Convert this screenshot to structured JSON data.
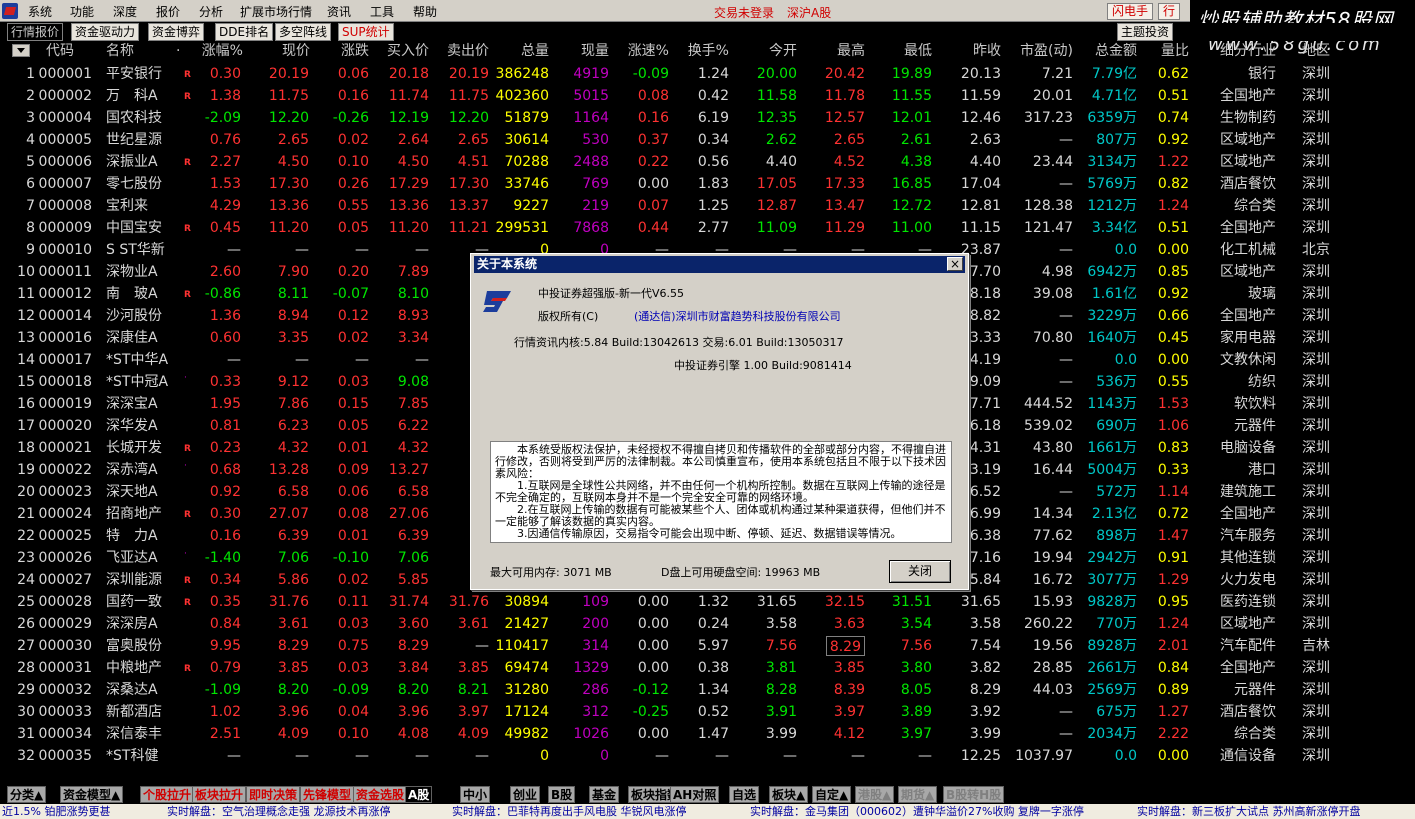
{
  "menu": [
    "系统",
    "功能",
    "深度",
    "报价",
    "分析",
    "扩展市场行情",
    "资讯",
    "工具",
    "帮助"
  ],
  "status": {
    "login": "交易未登录",
    "market": "深沪A股"
  },
  "toolbar": {
    "btn1": "闪电手",
    "btn2": "行"
  },
  "watermark": {
    "line1": "炒股辅助教材58股网",
    "line2": "www.58gu.com"
  },
  "top_tabs": [
    "行情报价",
    "资金驱动力",
    "资金博弈",
    "DDE排名",
    "多空阵线",
    "SUP统计"
  ],
  "theme_tab": "主题投资",
  "columns": [
    "代码",
    "名称",
    "·",
    "涨幅%",
    "现价",
    "涨跌",
    "买入价",
    "卖出价",
    "总量",
    "现量",
    "涨速%",
    "换手%",
    "今开",
    "最高",
    "最低",
    "昨收",
    "市盈(动)",
    "总金额",
    "量比",
    "细分行业",
    "地区"
  ],
  "rows": [
    [
      "1",
      "000001",
      "平安银行",
      "R",
      "0.30",
      "20.19",
      "0.06",
      "20.18",
      "20.19",
      "386248",
      "4919",
      "-0.09",
      "1.24",
      "20.00",
      "20.42",
      "19.89",
      "20.13",
      "7.21",
      "7.79亿",
      "0.62",
      "银行",
      "深圳"
    ],
    [
      "2",
      "000002",
      "万　科A",
      "R",
      "1.38",
      "11.75",
      "0.16",
      "11.74",
      "11.75",
      "402360",
      "5015",
      "0.08",
      "0.42",
      "11.58",
      "11.78",
      "11.55",
      "11.59",
      "20.01",
      "4.71亿",
      "0.51",
      "全国地产",
      "深圳"
    ],
    [
      "3",
      "000004",
      "国农科技",
      "",
      "-2.09",
      "12.20",
      "-0.26",
      "12.19",
      "12.20",
      "51879",
      "1164",
      "0.16",
      "6.19",
      "12.35",
      "12.57",
      "12.01",
      "12.46",
      "317.23",
      "6359万",
      "0.74",
      "生物制药",
      "深圳"
    ],
    [
      "4",
      "000005",
      "世纪星源",
      "",
      "0.76",
      "2.65",
      "0.02",
      "2.64",
      "2.65",
      "30614",
      "530",
      "0.37",
      "0.34",
      "2.62",
      "2.65",
      "2.61",
      "2.63",
      "—",
      "807万",
      "0.92",
      "区域地产",
      "深圳"
    ],
    [
      "5",
      "000006",
      "深振业A",
      "R",
      "2.27",
      "4.50",
      "0.10",
      "4.50",
      "4.51",
      "70288",
      "2488",
      "0.22",
      "0.56",
      "4.40",
      "4.52",
      "4.38",
      "4.40",
      "23.44",
      "3134万",
      "1.22",
      "区域地产",
      "深圳"
    ],
    [
      "6",
      "000007",
      "零七股份",
      "",
      "1.53",
      "17.30",
      "0.26",
      "17.29",
      "17.30",
      "33746",
      "769",
      "0.00",
      "1.83",
      "17.05",
      "17.33",
      "16.85",
      "17.04",
      "—",
      "5769万",
      "0.82",
      "酒店餐饮",
      "深圳"
    ],
    [
      "7",
      "000008",
      "宝利来",
      "",
      "4.29",
      "13.36",
      "0.55",
      "13.36",
      "13.37",
      "9227",
      "219",
      "0.07",
      "1.25",
      "12.87",
      "13.47",
      "12.72",
      "12.81",
      "128.38",
      "1212万",
      "1.24",
      "综合类",
      "深圳"
    ],
    [
      "8",
      "000009",
      "中国宝安",
      "R",
      "0.45",
      "11.20",
      "0.05",
      "11.20",
      "11.21",
      "299531",
      "7868",
      "0.44",
      "2.77",
      "11.09",
      "11.29",
      "11.00",
      "11.15",
      "121.47",
      "3.34亿",
      "0.51",
      "全国地产",
      "深圳"
    ],
    [
      "9",
      "000010",
      "S ST华新",
      "",
      "—",
      "—",
      "—",
      "—",
      "—",
      "0",
      "0",
      "—",
      "—",
      "—",
      "—",
      "—",
      "23.87",
      "—",
      "0.0",
      "0.00",
      "化工机械",
      "北京"
    ],
    [
      "10",
      "000011",
      "深物业A",
      "",
      "2.60",
      "7.90",
      "0.20",
      "7.89",
      "",
      "",
      "",
      "",
      "",
      "",
      "",
      "",
      "7.70",
      "4.98",
      "6942万",
      "0.85",
      "区域地产",
      "深圳"
    ],
    [
      "11",
      "000012",
      "南　玻A",
      "R",
      "-0.86",
      "8.11",
      "-0.07",
      "8.10",
      "",
      "",
      "",
      "",
      "",
      "",
      "",
      "",
      "8.18",
      "39.08",
      "1.61亿",
      "0.92",
      "玻璃",
      "深圳"
    ],
    [
      "12",
      "000014",
      "沙河股份",
      "",
      "1.36",
      "8.94",
      "0.12",
      "8.93",
      "",
      "",
      "",
      "",
      "",
      "",
      "",
      "",
      "8.82",
      "—",
      "3229万",
      "0.66",
      "全国地产",
      "深圳"
    ],
    [
      "13",
      "000016",
      "深康佳A",
      "",
      "0.60",
      "3.35",
      "0.02",
      "3.34",
      "",
      "",
      "",
      "",
      "",
      "",
      "",
      "",
      "3.33",
      "70.80",
      "1640万",
      "0.45",
      "家用电器",
      "深圳"
    ],
    [
      "14",
      "000017",
      "*ST中华A",
      "",
      "—",
      "—",
      "—",
      "—",
      "",
      "",
      "",
      "",
      "",
      "",
      "",
      "",
      "4.19",
      "—",
      "0.0",
      "0.00",
      "文教休闲",
      "深圳"
    ],
    [
      "15",
      "000018",
      "*ST中冠A",
      "·",
      "0.33",
      "9.12",
      "0.03",
      "9.08",
      "",
      "",
      "",
      "",
      "",
      "",
      "",
      "",
      "9.09",
      "—",
      "536万",
      "0.55",
      "纺织",
      "深圳"
    ],
    [
      "16",
      "000019",
      "深深宝A",
      "",
      "1.95",
      "7.86",
      "0.15",
      "7.85",
      "",
      "",
      "",
      "",
      "",
      "",
      "",
      "",
      "7.71",
      "444.52",
      "1143万",
      "1.53",
      "软饮料",
      "深圳"
    ],
    [
      "17",
      "000020",
      "深华发A",
      "",
      "0.81",
      "6.23",
      "0.05",
      "6.22",
      "",
      "",
      "",
      "",
      "",
      "",
      "",
      "",
      "6.18",
      "539.02",
      "690万",
      "1.06",
      "元器件",
      "深圳"
    ],
    [
      "18",
      "000021",
      "长城开发",
      "R",
      "0.23",
      "4.32",
      "0.01",
      "4.32",
      "",
      "",
      "",
      "",
      "",
      "",
      "",
      "",
      "4.31",
      "43.80",
      "1661万",
      "0.83",
      "电脑设备",
      "深圳"
    ],
    [
      "19",
      "000022",
      "深赤湾A",
      "·",
      "0.68",
      "13.28",
      "0.09",
      "13.27",
      "",
      "",
      "",
      "",
      "",
      "",
      "",
      "",
      "13.19",
      "16.44",
      "5004万",
      "0.33",
      "港口",
      "深圳"
    ],
    [
      "20",
      "000023",
      "深天地A",
      "",
      "0.92",
      "6.58",
      "0.06",
      "6.58",
      "",
      "",
      "",
      "",
      "",
      "",
      "",
      "",
      "6.52",
      "—",
      "572万",
      "1.14",
      "建筑施工",
      "深圳"
    ],
    [
      "21",
      "000024",
      "招商地产",
      "R",
      "0.30",
      "27.07",
      "0.08",
      "27.06",
      "",
      "",
      "",
      "",
      "",
      "",
      "",
      "",
      "26.99",
      "14.34",
      "2.13亿",
      "0.72",
      "全国地产",
      "深圳"
    ],
    [
      "22",
      "000025",
      "特　力A",
      "",
      "0.16",
      "6.39",
      "0.01",
      "6.39",
      "",
      "",
      "",
      "",
      "",
      "",
      "",
      "",
      "6.38",
      "77.62",
      "898万",
      "1.47",
      "汽车服务",
      "深圳"
    ],
    [
      "23",
      "000026",
      "飞亚达A",
      "·",
      "-1.40",
      "7.06",
      "-0.10",
      "7.06",
      "",
      "",
      "",
      "",
      "",
      "",
      "",
      "",
      "7.16",
      "19.94",
      "2942万",
      "0.91",
      "其他连锁",
      "深圳"
    ],
    [
      "24",
      "000027",
      "深圳能源",
      "R",
      "0.34",
      "5.86",
      "0.02",
      "5.85",
      "",
      "",
      "",
      "",
      "",
      "",
      "",
      "",
      "5.84",
      "16.72",
      "3077万",
      "1.29",
      "火力发电",
      "深圳"
    ],
    [
      "25",
      "000028",
      "国药一致",
      "R",
      "0.35",
      "31.76",
      "0.11",
      "31.74",
      "31.76",
      "30894",
      "109",
      "0.00",
      "1.32",
      "31.65",
      "32.15",
      "31.51",
      "31.65",
      "15.93",
      "9828万",
      "0.95",
      "医药连锁",
      "深圳"
    ],
    [
      "26",
      "000029",
      "深深房A",
      "",
      "0.84",
      "3.61",
      "0.03",
      "3.60",
      "3.61",
      "21427",
      "200",
      "0.00",
      "0.24",
      "3.58",
      "3.63",
      "3.54",
      "3.58",
      "260.22",
      "770万",
      "1.24",
      "区域地产",
      "深圳"
    ],
    [
      "27",
      "000030",
      "富奥股份",
      "",
      "9.95",
      "8.29",
      "0.75",
      "8.29",
      "—",
      "110417",
      "314",
      "0.00",
      "5.97",
      "7.56",
      "8.29",
      "7.56",
      "7.54",
      "19.56",
      "8928万",
      "2.01",
      "汽车配件",
      "吉林"
    ],
    [
      "28",
      "000031",
      "中粮地产",
      "R",
      "0.79",
      "3.85",
      "0.03",
      "3.84",
      "3.85",
      "69474",
      "1329",
      "0.00",
      "0.38",
      "3.81",
      "3.85",
      "3.80",
      "3.82",
      "28.85",
      "2661万",
      "0.84",
      "全国地产",
      "深圳"
    ],
    [
      "29",
      "000032",
      "深桑达A",
      "",
      "-1.09",
      "8.20",
      "-0.09",
      "8.20",
      "8.21",
      "31280",
      "286",
      "-0.12",
      "1.34",
      "8.28",
      "8.39",
      "8.05",
      "8.29",
      "44.03",
      "2569万",
      "0.89",
      "元器件",
      "深圳"
    ],
    [
      "30",
      "000033",
      "新都酒店",
      "",
      "1.02",
      "3.96",
      "0.04",
      "3.96",
      "3.97",
      "17124",
      "312",
      "-0.25",
      "0.52",
      "3.91",
      "3.97",
      "3.89",
      "3.92",
      "—",
      "675万",
      "1.27",
      "酒店餐饮",
      "深圳"
    ],
    [
      "31",
      "000034",
      "深信泰丰",
      "",
      "2.51",
      "4.09",
      "0.10",
      "4.08",
      "4.09",
      "49982",
      "1026",
      "0.00",
      "1.47",
      "3.99",
      "4.12",
      "3.97",
      "3.99",
      "—",
      "2034万",
      "2.22",
      "综合类",
      "深圳"
    ],
    [
      "32",
      "000035",
      "*ST科健",
      "",
      "—",
      "—",
      "—",
      "—",
      "—",
      "0",
      "0",
      "—",
      "—",
      "—",
      "—",
      "—",
      "12.25",
      "1037.97",
      "0.0",
      "0.00",
      "通信设备",
      "深圳"
    ]
  ],
  "colors": {
    "up": "#ff3232",
    "down": "#00e600",
    "neutral": "#d8d8d8",
    "amount": "#00c8c8",
    "volume": "#ffff00",
    "flow": "#c000c0"
  },
  "dialog": {
    "title": "关于本系统",
    "close": "×",
    "product": "中投证券超强版-新一代V6.55",
    "copyright_label": "版权所有(C)",
    "company": "(通达信)深圳市财富趋势科技股份有限公司",
    "core": "行情资讯内核:5.84 Build:13042613 交易:6.01 Build:13050317",
    "engine": "中投证券引擎 1.00 Build:9081414",
    "notice": [
      "　　本系统受版权法保护，未经授权不得擅自拷贝和传播软件的全部或部分内容，不得擅自进行修改，否则将受到严厉的法律制裁。本公司慎重宣布，使用本系统包括且不限于以下技术因素风险：",
      "　　1.互联网是全球性公共网络，并不由任何一个机构所控制。数据在互联网上传输的途径是不完全确定的，互联网本身并不是一个完全安全可靠的网络环境。",
      "　　2.在互联网上传输的数据有可能被某些个人、团体或机构通过某种渠道获得，但他们并不一定能够了解该数据的真实内容。",
      "　　3.因通信传输原因，交易指令可能会出现中断、停顿、延迟、数据错误等情况。"
    ],
    "memory": "最大可用内存: 3071 MB",
    "disk": "D盘上可用硬盘空间: 19963 MB",
    "close_button": "关闭"
  },
  "bottom_tabs": [
    "分类▲",
    "资金模型▲",
    "个股拉升",
    "板块拉升",
    "即时决策",
    "先锋模型",
    "资金选股",
    "A股",
    "中小",
    "创业",
    "B股",
    "基金",
    "板块指数",
    "AH对照",
    "自选",
    "板块▲",
    "自定▲",
    "港股▲",
    "期货▲",
    "B股转H股"
  ],
  "ticker": [
    "近1.5% 铂肥涨势更甚",
    "实时解盘：空气治理概念走强 龙源技术再涨停",
    "实时解盘：巴菲特再度出手风电股 华锐风电涨停",
    "实时解盘：金马集团（000602）遭钟华溢价27%收购 复牌一字涨停",
    "实时解盘：新三板扩大试点 苏州高新涨停开盘"
  ]
}
